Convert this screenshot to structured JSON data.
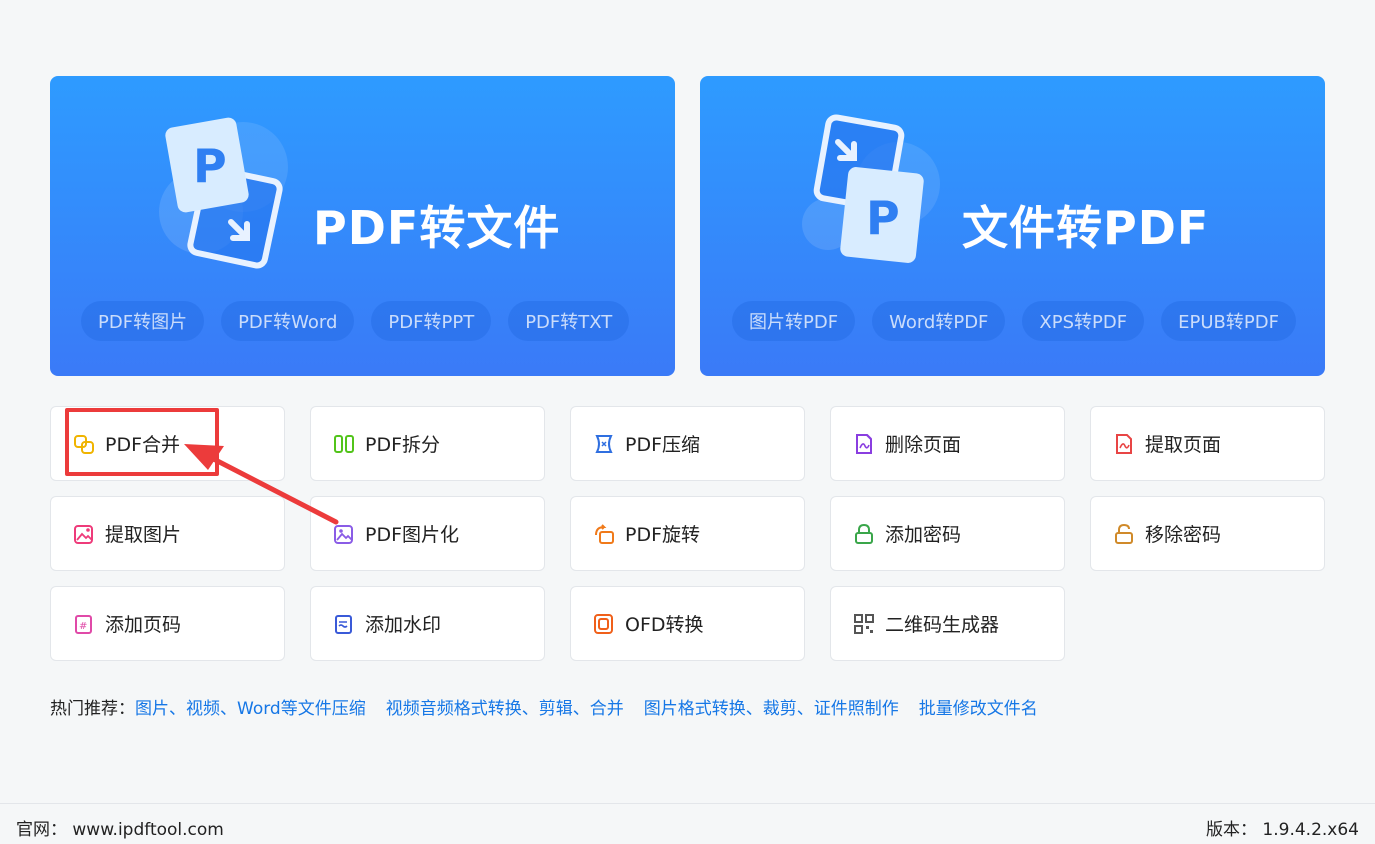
{
  "banners": {
    "left": {
      "title": "PDF转文件",
      "chips": [
        "PDF转图片",
        "PDF转Word",
        "PDF转PPT",
        "PDF转TXT"
      ]
    },
    "right": {
      "title": "文件转PDF",
      "chips": [
        "图片转PDF",
        "Word转PDF",
        "XPS转PDF",
        "EPUB转PDF"
      ]
    }
  },
  "tools": [
    {
      "label": "PDF合并",
      "icon": "merge-icon",
      "color": "#f0b400"
    },
    {
      "label": "PDF拆分",
      "icon": "split-icon",
      "color": "#52c41a"
    },
    {
      "label": "PDF压缩",
      "icon": "compress-icon",
      "color": "#2f6fe0"
    },
    {
      "label": "删除页面",
      "icon": "delete-page-icon",
      "color": "#8a3ee0"
    },
    {
      "label": "提取页面",
      "icon": "extract-page-icon",
      "color": "#e84545"
    },
    {
      "label": "提取图片",
      "icon": "extract-image-icon",
      "color": "#ee3b7a"
    },
    {
      "label": "PDF图片化",
      "icon": "pdf-to-image-icon",
      "color": "#8a5ce6"
    },
    {
      "label": "PDF旋转",
      "icon": "rotate-icon",
      "color": "#f07a1a"
    },
    {
      "label": "添加密码",
      "icon": "lock-icon",
      "color": "#3aa64a"
    },
    {
      "label": "移除密码",
      "icon": "unlock-icon",
      "color": "#d08a2a"
    },
    {
      "label": "添加页码",
      "icon": "page-number-icon",
      "color": "#e04aa8"
    },
    {
      "label": "添加水印",
      "icon": "watermark-icon",
      "color": "#3a5ad8"
    },
    {
      "label": "OFD转换",
      "icon": "ofd-icon",
      "color": "#f0601a"
    },
    {
      "label": "二维码生成器",
      "icon": "qrcode-icon",
      "color": "#555555"
    }
  ],
  "hot": {
    "label": "热门推荐：",
    "links": [
      "图片、视频、Word等文件压缩",
      "视频音频格式转换、剪辑、合并",
      "图片格式转换、裁剪、证件照制作",
      "批量修改文件名"
    ]
  },
  "footer": {
    "site": "官网：  www.ipdftool.com",
    "version": "版本：  1.9.4.2.x64"
  },
  "colors": {
    "banner_gradient_top": "#2e9bff",
    "banner_gradient_bottom": "#3a7af7",
    "highlight": "#ec3b3b",
    "link": "#1677e6"
  }
}
